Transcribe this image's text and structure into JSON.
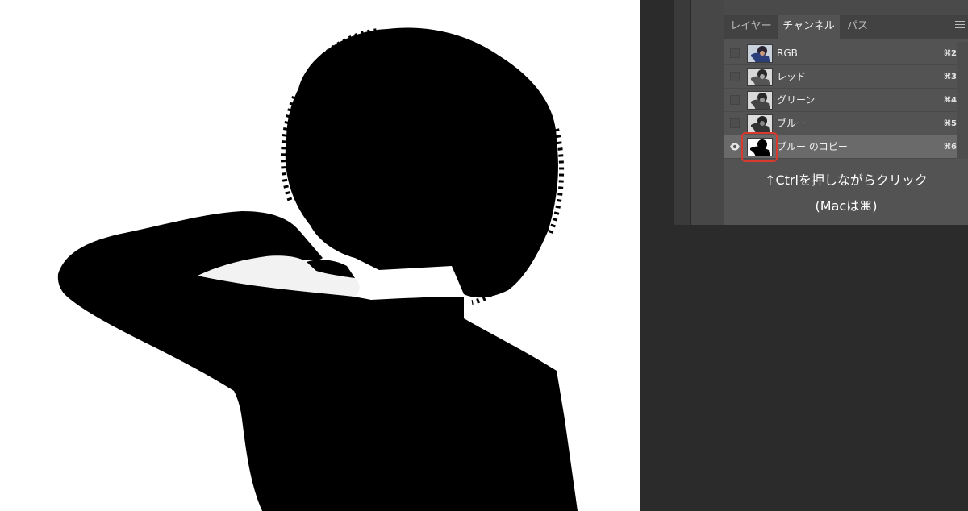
{
  "panel": {
    "tabs": [
      {
        "label": "レイヤー",
        "active": false
      },
      {
        "label": "チャンネル",
        "active": true
      },
      {
        "label": "パス",
        "active": false
      }
    ],
    "menu_icon": "hamburger-menu-icon",
    "channels": [
      {
        "name": "RGB",
        "shortcut": "⌘2",
        "visible": false,
        "thumb": "color-portrait"
      },
      {
        "name": "レッド",
        "shortcut": "⌘3",
        "visible": false,
        "thumb": "gray-portrait"
      },
      {
        "name": "グリーン",
        "shortcut": "⌘4",
        "visible": false,
        "thumb": "gray-portrait"
      },
      {
        "name": "ブルー",
        "shortcut": "⌘5",
        "visible": false,
        "thumb": "gray-portrait"
      },
      {
        "name": "ブルー のコピー",
        "shortcut": "⌘6",
        "visible": true,
        "selected": true,
        "thumb": "silhouette-mask"
      }
    ]
  },
  "annotation": {
    "line1": "↑Ctrlを押しながらクリック",
    "line2": "(Macは⌘)"
  },
  "colors": {
    "canvas_bg": "#ffffff",
    "silhouette": "#000000",
    "panel_bg": "#535353",
    "highlight_border": "#d83a2e"
  }
}
